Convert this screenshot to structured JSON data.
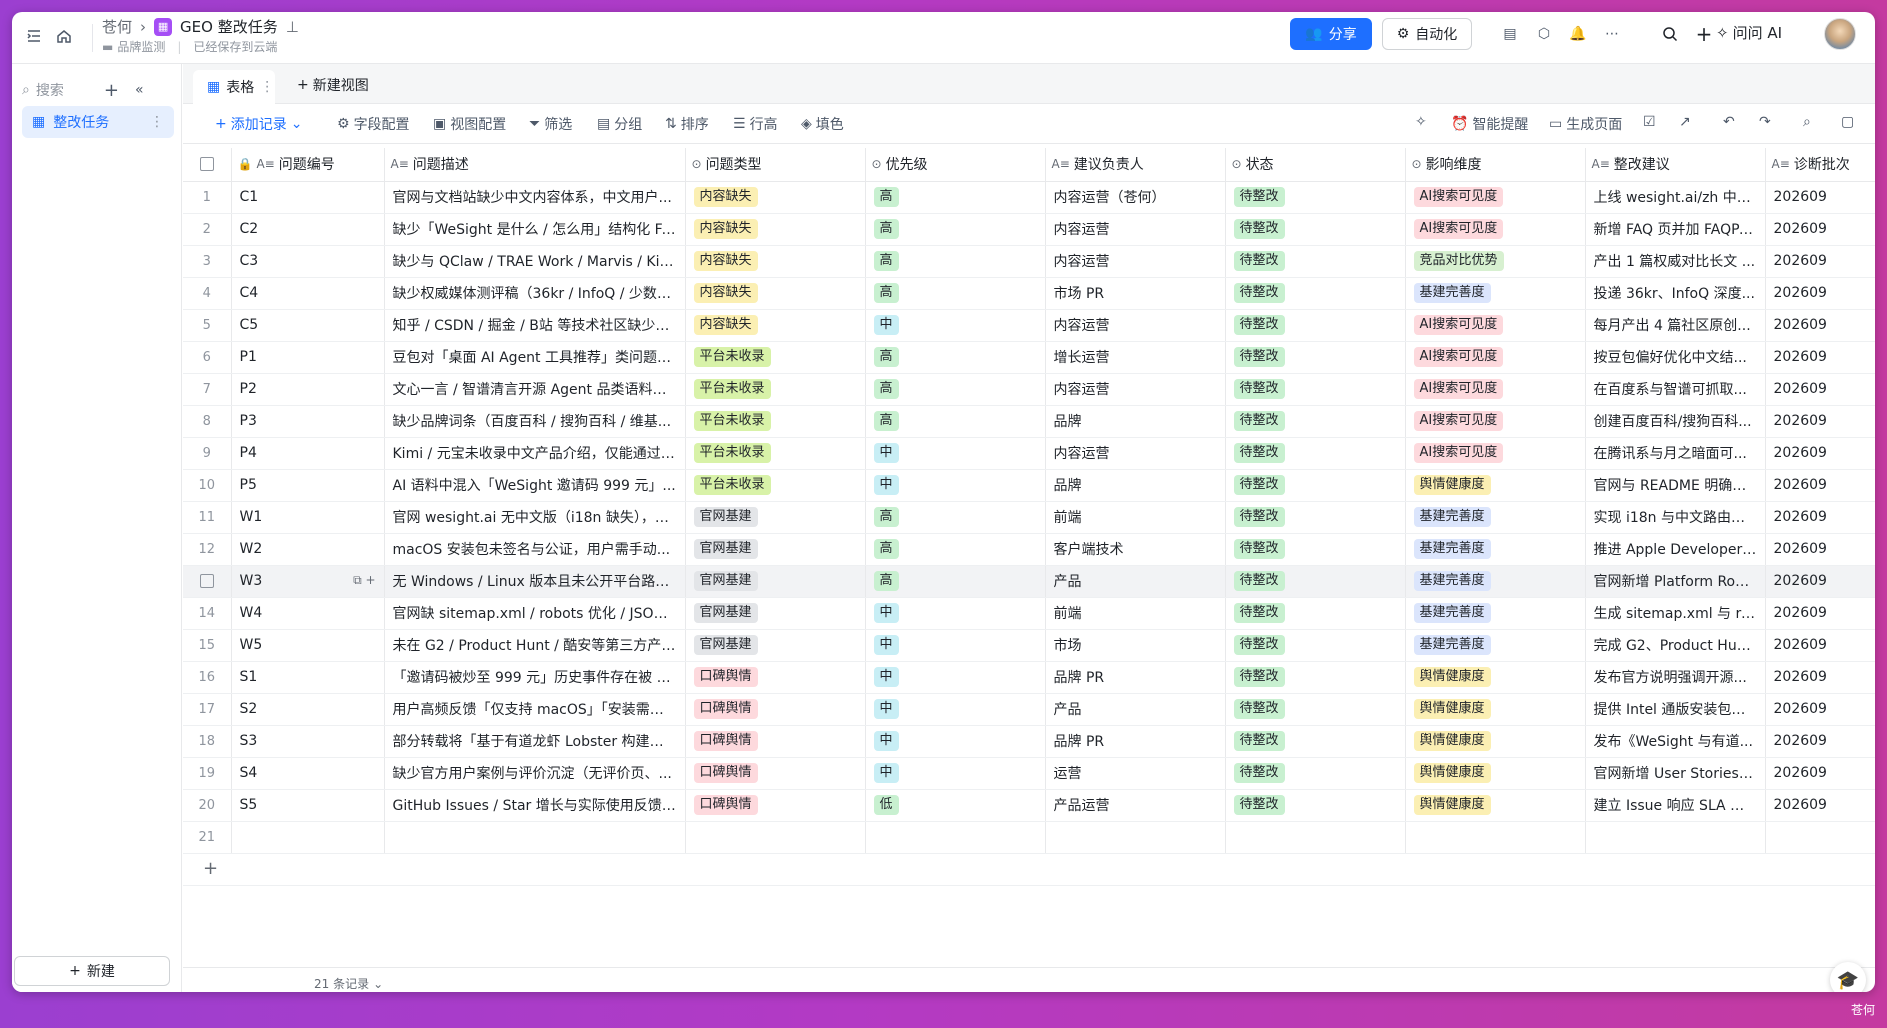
{
  "topbar": {
    "workspace": "苍何",
    "doc_title": "GEO 整改任务",
    "folder": "品牌监测",
    "save_status": "已经保存到云端",
    "share_label": "分享",
    "automation_label": "自动化",
    "ask_ai_label": "问问 AI"
  },
  "sidebar": {
    "search_placeholder": "搜索",
    "items": [
      {
        "label": "整改任务"
      }
    ],
    "new_label": "新建"
  },
  "views": {
    "tabs": [
      {
        "label": "表格"
      }
    ],
    "new_view_label": "新建视图"
  },
  "toolbar": {
    "add_record": "添加记录",
    "field_config": "字段配置",
    "view_config": "视图配置",
    "filter": "筛选",
    "group": "分组",
    "sort": "排序",
    "row_height": "行高",
    "fill_color": "填色",
    "smart_reminder": "智能提醒",
    "generate_page": "生成页面"
  },
  "columns": [
    "问题编号",
    "问题描述",
    "问题类型",
    "优先级",
    "建议负责人",
    "状态",
    "影响维度",
    "整改建议",
    "诊断批次"
  ],
  "tag_colors": {
    "内容缺失": "#fbefb3",
    "平台未收录": "#d8f2a8",
    "官网基建": "#e3e5e8",
    "口碑舆情": "#fdd9dd",
    "高": "#c8f0d0",
    "中": "#c8eef5",
    "低": "#c8f0d0",
    "待整改": "#c8f0d0",
    "AI搜索可见度": "#fdd9dd",
    "竞品对比优势": "#d7f0d0",
    "基建完善度": "#dbe5fc",
    "舆情健康度": "#fbefb3"
  },
  "rows": [
    {
      "n": "1",
      "id": "C1",
      "desc": "官网与文档站缺少中文内容体系，中文用户...",
      "type": "内容缺失",
      "prio": "高",
      "owner": "内容运营（苍何）",
      "status": "待整改",
      "impact": "AI搜索可见度",
      "advice": "上线 wesight.ai/zh 中文...",
      "batch": "202609"
    },
    {
      "n": "2",
      "id": "C2",
      "desc": "缺少「WeSight 是什么 / 怎么用」结构化 FA...",
      "type": "内容缺失",
      "prio": "高",
      "owner": "内容运营",
      "status": "待整改",
      "impact": "AI搜索可见度",
      "advice": "新增 FAQ 页并加 FAQPa...",
      "batch": "202609"
    },
    {
      "n": "3",
      "id": "C3",
      "desc": "缺少与 QClaw / TRAE Work / Marvis / Kimi ...",
      "type": "内容缺失",
      "prio": "高",
      "owner": "内容运营",
      "status": "待整改",
      "impact": "竞品对比优势",
      "advice": "产出 1 篇权威对比长文 ...",
      "batch": "202609"
    },
    {
      "n": "4",
      "id": "C4",
      "desc": "缺少权威媒体测评稿（36kr / InfoQ / 少数派...",
      "type": "内容缺失",
      "prio": "高",
      "owner": "市场 PR",
      "status": "待整改",
      "impact": "基建完善度",
      "advice": "投递 36kr、InfoQ 深度...",
      "batch": "202609"
    },
    {
      "n": "5",
      "id": "C5",
      "desc": "知乎 / CSDN / 掘金 / B站 等技术社区缺少高...",
      "type": "内容缺失",
      "prio": "中",
      "owner": "内容运营",
      "status": "待整改",
      "impact": "AI搜索可见度",
      "advice": "每月产出 4 篇社区原创...",
      "batch": "202609"
    },
    {
      "n": "6",
      "id": "P1",
      "desc": "豆包对「桌面 AI Agent 工具推荐」类问题提...",
      "type": "平台未收录",
      "prio": "高",
      "owner": "增长运营",
      "status": "待整改",
      "impact": "AI搜索可见度",
      "advice": "按豆包偏好优化中文结...",
      "batch": "202609"
    },
    {
      "n": "7",
      "id": "P2",
      "desc": "文心一言 / 智谱清言开源 Agent 品类语料缺...",
      "type": "平台未收录",
      "prio": "高",
      "owner": "内容运营",
      "status": "待整改",
      "impact": "AI搜索可见度",
      "advice": "在百度系与智谱可抓取...",
      "batch": "202609"
    },
    {
      "n": "8",
      "id": "P3",
      "desc": "缺少品牌词条（百度百科 / 搜狗百科 / 维基...",
      "type": "平台未收录",
      "prio": "高",
      "owner": "品牌",
      "status": "待整改",
      "impact": "AI搜索可见度",
      "advice": "创建百度百科/搜狗百科...",
      "batch": "202609"
    },
    {
      "n": "9",
      "id": "P4",
      "desc": "Kimi / 元宝未收录中文产品介绍，仅能通过 ...",
      "type": "平台未收录",
      "prio": "中",
      "owner": "内容运营",
      "status": "待整改",
      "impact": "AI搜索可见度",
      "advice": "在腾讯系与月之暗面可...",
      "batch": "202609"
    },
    {
      "n": "10",
      "id": "P5",
      "desc": "AI 语料中混入「WeSight 邀请码 999 元」...",
      "type": "平台未收录",
      "prio": "中",
      "owner": "品牌",
      "status": "待整改",
      "impact": "舆情健康度",
      "advice": "官网与 README 明确「...",
      "batch": "202609"
    },
    {
      "n": "11",
      "id": "W1",
      "desc": "官网 wesight.ai 无中文版（i18n 缺失），中...",
      "type": "官网基建",
      "prio": "高",
      "owner": "前端",
      "status": "待整改",
      "impact": "基建完善度",
      "advice": "实现 i18n 与中文路由，...",
      "batch": "202609"
    },
    {
      "n": "12",
      "id": "W2",
      "desc": "macOS 安装包未签名与公证，用户需手动...",
      "type": "官网基建",
      "prio": "高",
      "owner": "客户端技术",
      "status": "待整改",
      "impact": "基建完善度",
      "advice": "推进 Apple Developer ...",
      "batch": "202609"
    },
    {
      "n": "13",
      "id": "W3",
      "desc": "无 Windows / Linux 版本且未公开平台路线...",
      "type": "官网基建",
      "prio": "高",
      "owner": "产品",
      "status": "待整改",
      "impact": "基建完善度",
      "advice": "官网新增 Platform Road...",
      "batch": "202609"
    },
    {
      "n": "14",
      "id": "W4",
      "desc": "官网缺 sitemap.xml / robots 优化 / JSON-L...",
      "type": "官网基建",
      "prio": "中",
      "owner": "前端",
      "status": "待整改",
      "impact": "基建完善度",
      "advice": "生成 sitemap.xml 与 ro...",
      "batch": "202609"
    },
    {
      "n": "15",
      "id": "W5",
      "desc": "未在 G2 / Product Hunt / 酷安等第三方产品...",
      "type": "官网基建",
      "prio": "中",
      "owner": "市场",
      "status": "待整改",
      "impact": "基建完善度",
      "advice": "完成 G2、Product Hunt...",
      "batch": "202609"
    },
    {
      "n": "16",
      "id": "S1",
      "desc": "「邀请码被炒至 999 元」历史事件存在被 A...",
      "type": "口碑舆情",
      "prio": "中",
      "owner": "品牌 PR",
      "status": "待整改",
      "impact": "舆情健康度",
      "advice": "发布官方说明强调开源...",
      "batch": "202609"
    },
    {
      "n": "17",
      "id": "S2",
      "desc": "用户高频反馈「仅支持 macOS」「安装需绕...",
      "type": "口碑舆情",
      "prio": "中",
      "owner": "产品",
      "status": "待整改",
      "impact": "舆情健康度",
      "advice": "提供 Intel 通版安装包与...",
      "batch": "202609"
    },
    {
      "n": "18",
      "id": "S3",
      "desc": "部分转载将「基于有道龙虾 Lobster 构建」...",
      "type": "口碑舆情",
      "prio": "中",
      "owner": "品牌 PR",
      "status": "待整改",
      "impact": "舆情健康度",
      "advice": "发布《WeSight 与有道...",
      "batch": "202609"
    },
    {
      "n": "19",
      "id": "S4",
      "desc": "缺少官方用户案例与评价沉淀（无评价页、...",
      "type": "口碑舆情",
      "prio": "中",
      "owner": "运营",
      "status": "待整改",
      "impact": "舆情健康度",
      "advice": "官网新增 User Stories ...",
      "batch": "202609"
    },
    {
      "n": "20",
      "id": "S5",
      "desc": "GitHub Issues / Star 增长与实际使用反馈脱...",
      "type": "口碑舆情",
      "prio": "低",
      "owner": "产品运营",
      "status": "待整改",
      "impact": "舆情健康度",
      "advice": "建立 Issue 响应 SLA 与...",
      "batch": "202609"
    }
  ],
  "empty_row_number": "21",
  "footer": {
    "record_count": "21 条记录"
  },
  "corner_user": "苍何"
}
